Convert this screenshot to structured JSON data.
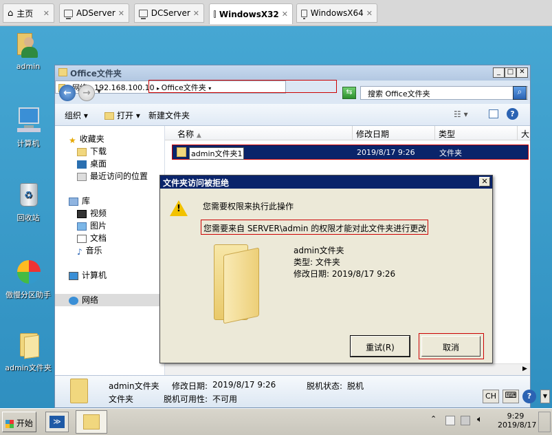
{
  "tabs": [
    {
      "label": "主页",
      "icon": "home-icon"
    },
    {
      "label": "ADServer",
      "icon": "vm-icon"
    },
    {
      "label": "DCServer",
      "icon": "vm-icon"
    },
    {
      "label": "WindowsX32",
      "icon": "vm-icon",
      "active": true
    },
    {
      "label": "WindowsX64",
      "icon": "vm-icon"
    }
  ],
  "desktop": {
    "icons": [
      {
        "label": "admin",
        "icon": "user-icon"
      },
      {
        "label": "计算机",
        "icon": "computer-icon"
      },
      {
        "label": "回收站",
        "icon": "recycle-bin-icon"
      },
      {
        "label": "傲慢分区助手",
        "icon": "partition-assistant-icon"
      },
      {
        "label": "admin文件夹",
        "icon": "folder-icon"
      }
    ]
  },
  "explorer": {
    "title": "Office文件夹",
    "address": {
      "root": "网络",
      "host": "192.168.100.10",
      "folder": "Office文件夹"
    },
    "search_placeholder": "搜索 Office文件夹",
    "toolbar": {
      "organize": "组织",
      "open": "打开",
      "new_folder": "新建文件夹"
    },
    "nav": {
      "favorites": "收藏夹",
      "favorite_items": [
        "下载",
        "桌面",
        "最近访问的位置"
      ],
      "libraries": "库",
      "library_items": [
        "视频",
        "图片",
        "文档",
        "音乐"
      ],
      "computer": "计算机",
      "network": "网络"
    },
    "columns": {
      "name": "名称",
      "modified": "修改日期",
      "type": "类型",
      "size": "大"
    },
    "rows": [
      {
        "name": "admin文件夹1",
        "modified": "2019/8/17 9:26",
        "type": "文件夹"
      }
    ],
    "details": {
      "name": "admin文件夹",
      "modified_label": "修改日期:",
      "modified": "2019/8/17 9:26",
      "offline_label": "脱机状态:",
      "offline": "脱机",
      "type": "文件夹",
      "availability_label": "脱机可用性:",
      "availability": "不可用"
    }
  },
  "dialog": {
    "title": "文件夹访问被拒绝",
    "message": "您需要权限来执行此操作",
    "detail": "您需要来自 SERVER\\admin 的权限才能对此文件夹进行更改",
    "folder_name": "admin文件夹",
    "type_line": "类型: 文件夹",
    "date_line": "修改日期: 2019/8/17 9:26",
    "retry": "重试(R)",
    "cancel": "取消"
  },
  "taskbar": {
    "start": "开始",
    "lang": "CH",
    "time": "9:29",
    "date": "2019/8/17"
  },
  "colors": {
    "selection": "#0a246a",
    "highlight_border": "#cc0000",
    "desktop": "#3e9dca"
  }
}
